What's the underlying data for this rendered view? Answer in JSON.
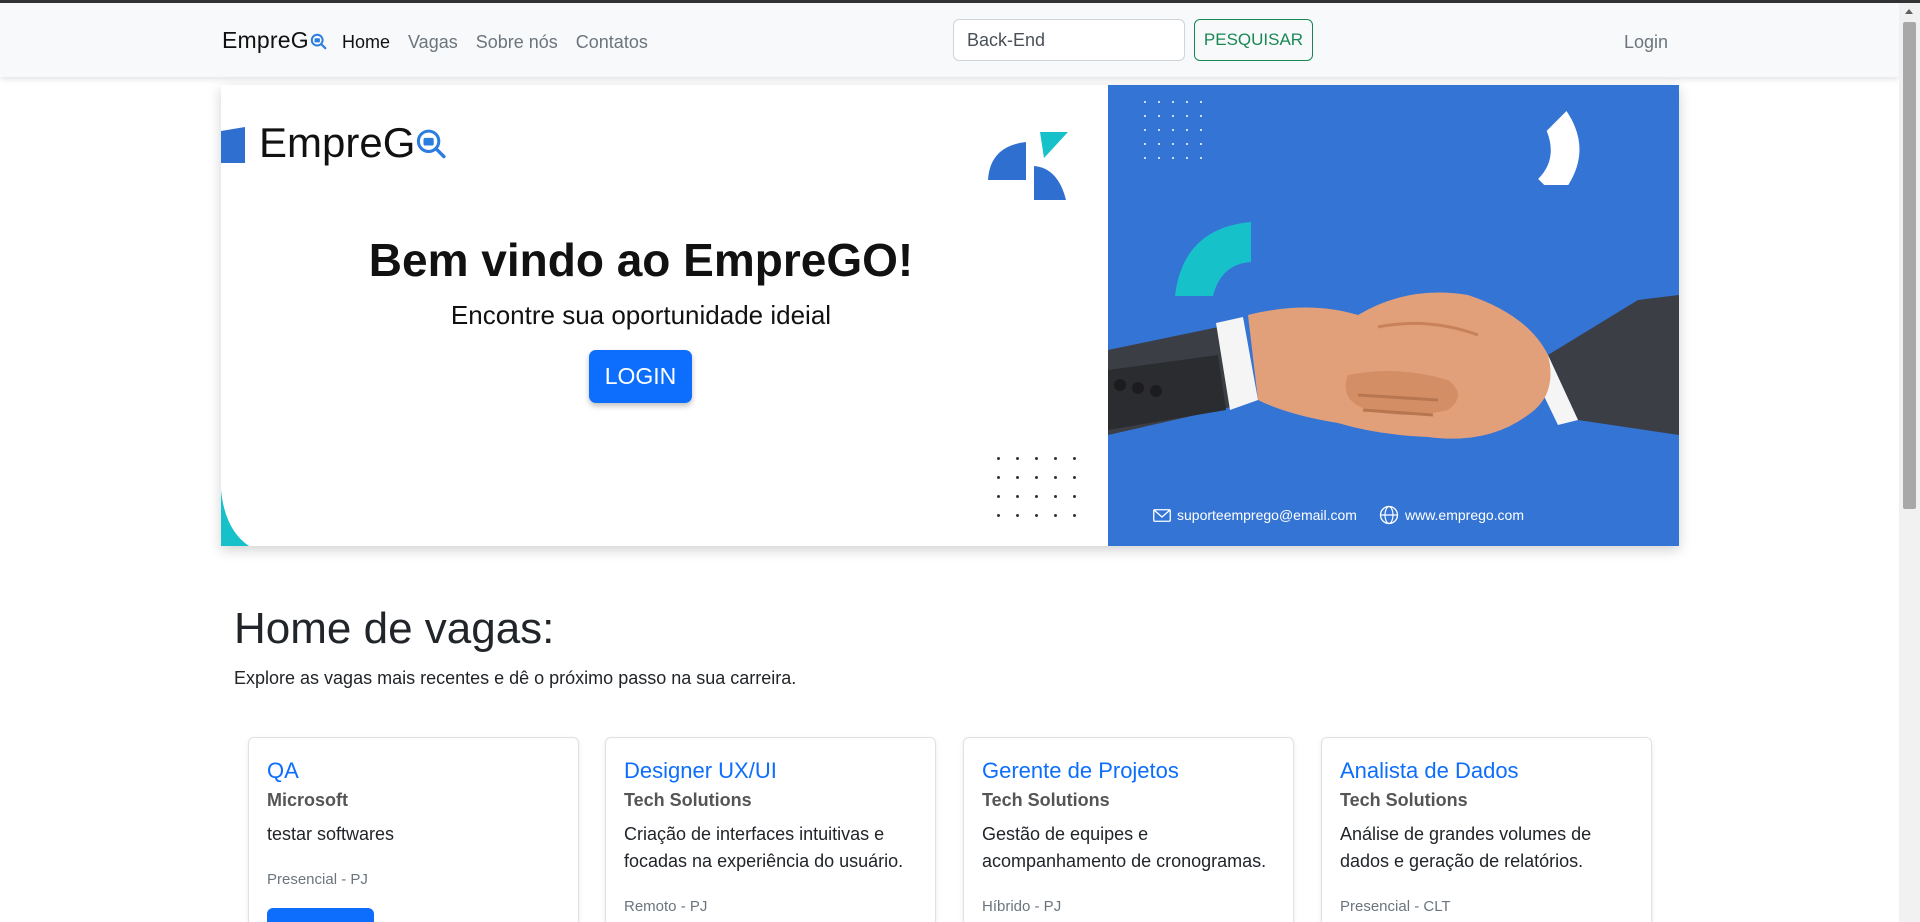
{
  "navbar": {
    "brand": "EmpreG",
    "links": [
      {
        "label": "Home",
        "active": true
      },
      {
        "label": "Vagas",
        "active": false
      },
      {
        "label": "Sobre nós",
        "active": false
      },
      {
        "label": "Contatos",
        "active": false
      }
    ],
    "search_value": "Back-End",
    "search_button": "PESQUISAR",
    "login": "Login"
  },
  "hero": {
    "logo_text": "EmpreG",
    "title": "Bem vindo ao EmpreGO!",
    "subtitle": "Encontre sua oportunidade ideial",
    "login_button": "LOGIN",
    "email": "suporteemprego@email.com",
    "website": "www.emprego.com"
  },
  "section": {
    "title": "Home de vagas:",
    "subtitle": "Explore as vagas mais recentes e dê o próximo passo na sua carreira."
  },
  "jobs": [
    {
      "title": "QA",
      "company": "Microsoft",
      "description": "testar softwares",
      "meta": "Presencial - PJ"
    },
    {
      "title": "Designer UX/UI",
      "company": "Tech Solutions",
      "description": "Criação de interfaces intuitivas e focadas na experiência do usuário.",
      "meta": "Remoto - PJ"
    },
    {
      "title": "Gerente de Projetos",
      "company": "Tech Solutions",
      "description": "Gestão de equipes e acompanhamento de cronogramas.",
      "meta": "Híbrido - PJ"
    },
    {
      "title": "Analista de Dados",
      "company": "Tech Solutions",
      "description": "Análise de grandes volumes de dados e geração de relatórios.",
      "meta": "Presencial - CLT"
    }
  ],
  "colors": {
    "primary": "#0d6efd",
    "success": "#198754",
    "hero_blue": "#3474d4",
    "teal": "#17c1c9"
  }
}
